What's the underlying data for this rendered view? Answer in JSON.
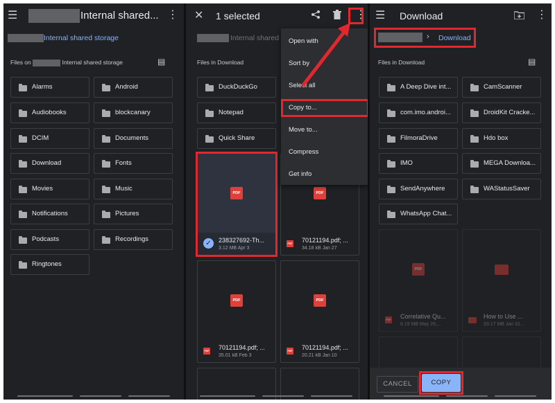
{
  "panel_left": {
    "title": "Internal shared...",
    "breadcrumb": "Internal shared storage",
    "section_prefix": "Files on",
    "section_suffix": "Internal shared storage",
    "folders": [
      "Alarms",
      "Android",
      "Audiobooks",
      "blockcanary",
      "DCIM",
      "Documents",
      "Download",
      "Fonts",
      "Movies",
      "Music",
      "Notifications",
      "Pictures",
      "Podcasts",
      "Recordings",
      "Ringtones"
    ]
  },
  "panel_middle": {
    "title": "1 selected",
    "breadcrumb": "Internal shared s",
    "section": "Files in Download",
    "folders": [
      "DuckDuckGo",
      "Notepad",
      "Quick Share"
    ],
    "files": [
      {
        "name": "238327692-Th...",
        "meta": "3.12 MB Apr 3",
        "icon": "PDF"
      },
      {
        "name": "70121194.pdf; ...",
        "meta": "34.18 kB Jan 27",
        "icon": "PDF"
      },
      {
        "name": "70121194.pdf; ...",
        "meta": "35.01 kB Feb 3",
        "icon": "PDF"
      },
      {
        "name": "70121194.pdf; ...",
        "meta": "20.21 kB Jan 10",
        "icon": "PDF"
      }
    ],
    "menu": [
      "Open with",
      "Sort by",
      "Select all",
      "Copy to...",
      "Move to...",
      "Compress",
      "Get info"
    ]
  },
  "panel_right": {
    "title": "Download",
    "breadcrumb": "Download",
    "section": "Files in Download",
    "folders": [
      "A Deep Dive int...",
      "CamScanner",
      "com.imo.androi...",
      "DroidKit Cracke...",
      "FilmoraDrive",
      "Hdo box",
      "IMO",
      "MEGA Downloa...",
      "SendAnywhere",
      "WAStatusSaver",
      "WhatsApp Chat..."
    ],
    "files": [
      {
        "name": "Correlative Qu...",
        "meta": "6.19 MB May 26,...",
        "icon": "PDF"
      },
      {
        "name": "How to Use ...",
        "meta": "93.17 MB Jan 31...",
        "icon": "video-icon"
      }
    ],
    "cancel_label": "CANCEL",
    "copy_label": "COPY"
  },
  "colors": {
    "highlight": "#e0282e",
    "accent": "#8ab4f8",
    "pdf": "#e0403a"
  }
}
